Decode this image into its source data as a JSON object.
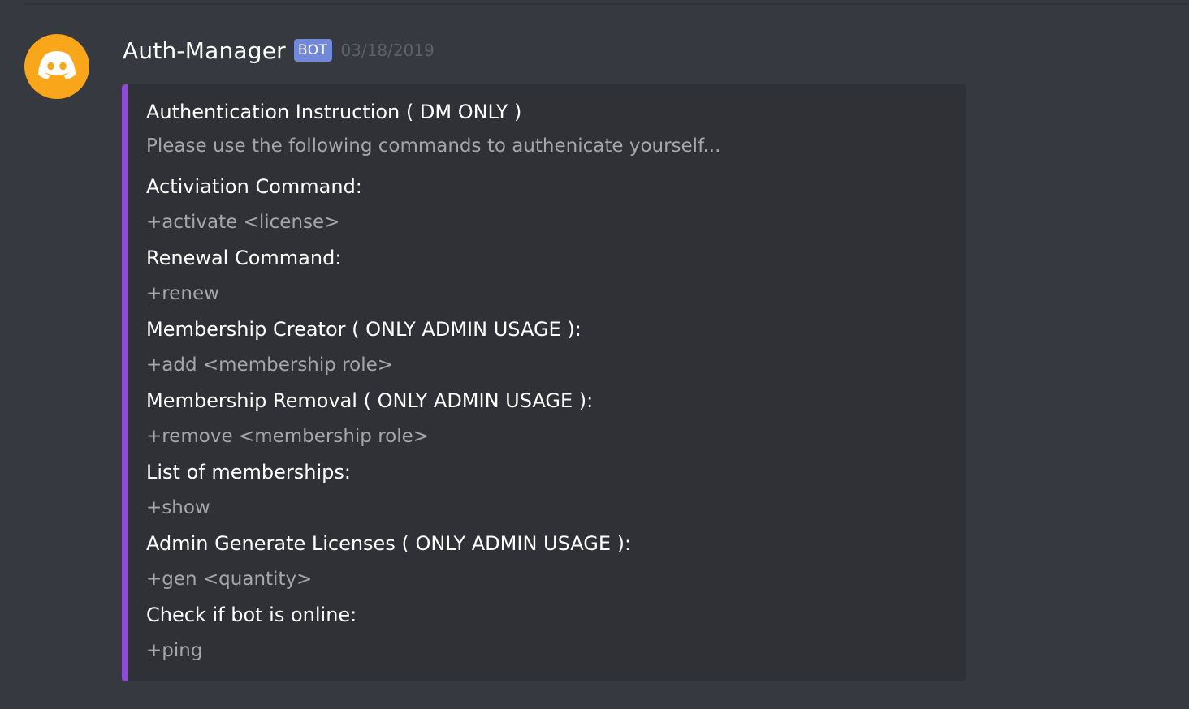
{
  "message": {
    "author": "Auth-Manager",
    "bot_tag": "BOT",
    "timestamp": "03/18/2019",
    "avatar_icon": "discord-logo-icon",
    "avatar_color": "#faa61a",
    "embed": {
      "accent_color": "#8e4bd6",
      "title": "Authentication Instruction ( DM ONLY )",
      "description": "Please use the following commands to authenicate yourself...",
      "fields": [
        {
          "name": "Activiation Command:",
          "value": "+activate <license>"
        },
        {
          "name": "Renewal Command:",
          "value": "+renew"
        },
        {
          "name": "Membership Creator ( ONLY ADMIN USAGE ):",
          "value": "+add <membership role>"
        },
        {
          "name": "Membership Removal ( ONLY ADMIN USAGE ):",
          "value": "+remove <membership role>"
        },
        {
          "name": "List of memberships:",
          "value": "+show"
        },
        {
          "name": "Admin Generate Licenses ( ONLY ADMIN USAGE ):",
          "value": "+gen <quantity>"
        },
        {
          "name": "Check if bot is online:",
          "value": "+ping"
        }
      ]
    }
  }
}
